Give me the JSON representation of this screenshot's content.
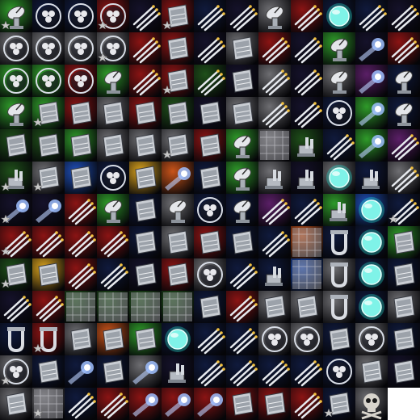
{
  "sheet": {
    "columns": 13,
    "rows": 13,
    "background": "#ffffff",
    "palette": {
      "green": "#2f9a2a",
      "darkgreen": "#1f4f1a",
      "red": "#8a1414",
      "navy": "#101a3c",
      "space": "#15122a",
      "grey": "#6e6e72",
      "steel": "#b8bcc2",
      "cyan": "#27e0d0",
      "gold": "#d9a21e",
      "orange": "#c9541a",
      "purple": "#5a1f66",
      "blue": "#1f4fb8"
    },
    "tiles": [
      [
        "satellite-dish",
        "mine-orb",
        "mine-orb",
        "mine-orb",
        "missile-battery",
        "armor-plate",
        "missile-battery",
        "missile-battery",
        "satellite-dish",
        "missile-battery",
        "shield-orb",
        "missile-battery",
        "missile-battery"
      ],
      [
        "mine-orb",
        "mine-orb",
        "mine-orb",
        "mine-orb",
        "missile-battery",
        "armor-plate",
        "missile-battery",
        "armor-plate",
        "missile-battery",
        "missile-battery",
        "satellite-dish",
        "thruster-beam",
        "missile-battery"
      ],
      [
        "mine-orb",
        "mine-orb",
        "mine-orb",
        "satellite-dish",
        "missile-battery",
        "armor-plate",
        "missile-battery",
        "armor-plate",
        "missile-battery",
        "missile-battery",
        "satellite-dish",
        "thruster-beam",
        "satellite-dish"
      ],
      [
        "satellite-dish",
        "armor-plate",
        "armor-plate",
        "armor-plate",
        "armor-plate",
        "armor-plate",
        "armor-plate",
        "armor-plate",
        "missile-battery",
        "missile-battery",
        "mine-orb",
        "thruster-beam",
        "satellite-dish"
      ],
      [
        "armor-plate",
        "armor-plate",
        "armor-plate",
        "armor-plate",
        "armor-plate",
        "armor-plate",
        "armor-plate",
        "satellite-dish",
        "texture-panel",
        "turret-gun",
        "missile-battery",
        "thruster-beam",
        "missile-battery"
      ],
      [
        "turret-gun",
        "armor-plate",
        "armor-plate",
        "mine-orb",
        "armor-plate",
        "thruster-beam",
        "armor-plate",
        "satellite-dish",
        "turret-gun",
        "turret-gun",
        "shield-orb",
        "turret-gun",
        "missile-battery"
      ],
      [
        "thruster-beam",
        "thruster-beam",
        "missile-battery",
        "satellite-dish",
        "armor-plate",
        "satellite-dish",
        "mine-orb",
        "satellite-dish",
        "missile-battery",
        "missile-battery",
        "turret-gun",
        "shield-orb",
        "missile-battery"
      ],
      [
        "missile-battery",
        "missile-battery",
        "missile-battery",
        "missile-battery",
        "armor-plate",
        "armor-plate",
        "armor-plate",
        "armor-plate",
        "missile-battery",
        "texture-panel",
        "clamp-hook",
        "shield-orb",
        "armor-plate"
      ],
      [
        "armor-plate",
        "armor-plate",
        "missile-battery",
        "missile-battery",
        "armor-plate",
        "armor-plate",
        "mine-orb",
        "missile-battery",
        "turret-gun",
        "texture-panel",
        "clamp-hook",
        "shield-orb",
        "armor-plate"
      ],
      [
        "missile-battery",
        "missile-battery",
        "texture-panel",
        "texture-panel",
        "texture-panel",
        "texture-panel",
        "armor-plate",
        "missile-battery",
        "armor-plate",
        "armor-plate",
        "clamp-hook",
        "shield-orb",
        "armor-plate"
      ],
      [
        "clamp-hook",
        "clamp-hook",
        "armor-plate",
        "armor-plate",
        "armor-plate",
        "shield-orb",
        "missile-battery",
        "missile-battery",
        "mine-orb",
        "mine-orb",
        "armor-plate",
        "mine-orb",
        "armor-plate"
      ],
      [
        "mine-orb",
        "armor-plate",
        "thruster-beam",
        "armor-plate",
        "thruster-beam",
        "turret-gun",
        "missile-battery",
        "missile-battery",
        "missile-battery",
        "missile-battery",
        "mine-orb",
        "armor-plate",
        "armor-plate"
      ],
      [
        "armor-plate",
        "texture-panel",
        "missile-battery",
        "missile-battery",
        "thruster-beam",
        "thruster-beam",
        "thruster-beam",
        "armor-plate",
        "armor-plate",
        "missile-battery",
        "armor-plate",
        "skull-emblem",
        "empty"
      ]
    ],
    "backgrounds": [
      [
        "green",
        "navy",
        "navy",
        "red",
        "space",
        "red",
        "navy",
        "space",
        "grey",
        "red",
        "navy",
        "navy",
        "space"
      ],
      [
        "grey",
        "grey",
        "grey",
        "grey",
        "red",
        "red",
        "space",
        "grey",
        "red",
        "space",
        "green",
        "space",
        "red"
      ],
      [
        "green",
        "green",
        "red",
        "green",
        "red",
        "red",
        "darkgreen",
        "space",
        "grey",
        "space",
        "grey",
        "purple",
        "navy"
      ],
      [
        "green",
        "green",
        "red",
        "grey",
        "red",
        "darkgreen",
        "space",
        "grey",
        "grey",
        "space",
        "navy",
        "green",
        "navy"
      ],
      [
        "darkgreen",
        "darkgreen",
        "green",
        "grey",
        "grey",
        "grey",
        "red",
        "green",
        "grey",
        "darkgreen",
        "navy",
        "green",
        "purple"
      ],
      [
        "darkgreen",
        "grey",
        "blue",
        "navy",
        "gold",
        "orange",
        "navy",
        "green",
        "grey",
        "space",
        "grey",
        "navy",
        "grey"
      ],
      [
        "space",
        "space",
        "red",
        "green",
        "navy",
        "grey",
        "navy",
        "navy",
        "purple",
        "navy",
        "green",
        "blue",
        "navy"
      ],
      [
        "red",
        "red",
        "red",
        "red",
        "navy",
        "grey",
        "red",
        "navy",
        "navy",
        "orange",
        "navy",
        "navy",
        "green"
      ],
      [
        "darkgreen",
        "gold",
        "red",
        "navy",
        "space",
        "red",
        "grey",
        "navy",
        "navy",
        "blue",
        "grey",
        "navy",
        "navy"
      ],
      [
        "space",
        "red",
        "darkgreen",
        "darkgreen",
        "darkgreen",
        "darkgreen",
        "navy",
        "red",
        "grey",
        "grey",
        "grey",
        "navy",
        "grey"
      ],
      [
        "navy",
        "red",
        "grey",
        "orange",
        "green",
        "navy",
        "navy",
        "navy",
        "grey",
        "grey",
        "navy",
        "grey",
        "navy"
      ],
      [
        "grey",
        "navy",
        "navy",
        "navy",
        "grey",
        "space",
        "navy",
        "navy",
        "navy",
        "navy",
        "navy",
        "grey",
        "space"
      ],
      [
        "grey",
        "grey",
        "navy",
        "red",
        "red",
        "red",
        "red",
        "red",
        "red",
        "red",
        "navy",
        "grey",
        "space"
      ]
    ],
    "starred": [
      [
        0,
        0
      ],
      [
        0,
        3
      ],
      [
        0,
        5
      ],
      [
        1,
        3
      ],
      [
        2,
        5
      ],
      [
        3,
        1
      ],
      [
        4,
        5
      ],
      [
        5,
        0
      ],
      [
        5,
        1
      ],
      [
        6,
        0
      ],
      [
        6,
        12
      ],
      [
        7,
        0
      ],
      [
        8,
        0
      ],
      [
        10,
        1
      ],
      [
        11,
        0
      ],
      [
        12,
        1
      ],
      [
        12,
        10
      ]
    ]
  }
}
